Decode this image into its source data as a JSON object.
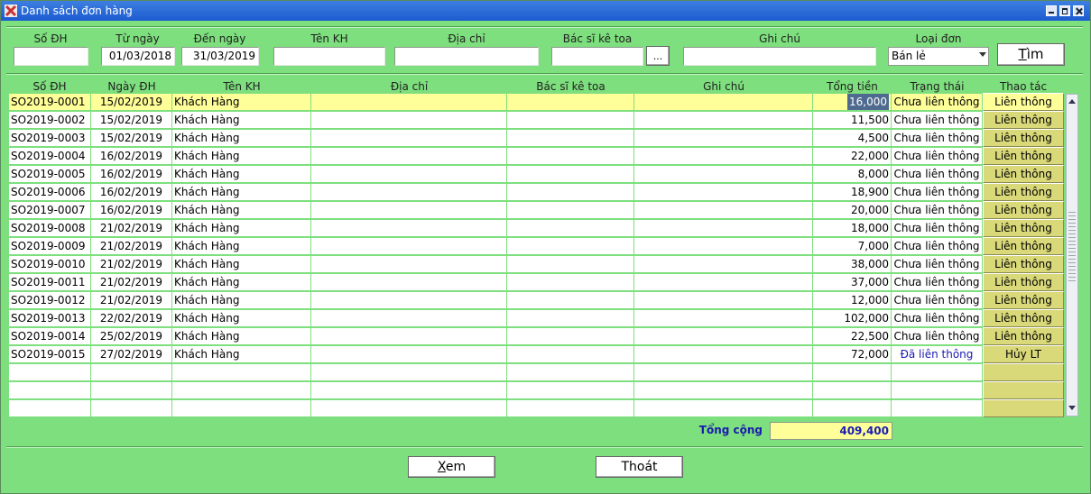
{
  "window": {
    "title": "Danh sách đơn hàng"
  },
  "filters": {
    "so_dh": {
      "label": "Số ĐH",
      "value": ""
    },
    "tu_ngay": {
      "label": "Từ ngày",
      "value": "01/03/2018"
    },
    "den_ngay": {
      "label": "Đến ngày",
      "value": "31/03/2019"
    },
    "ten_kh": {
      "label": "Tên KH",
      "value": ""
    },
    "dia_chi": {
      "label": "Địa chỉ",
      "value": ""
    },
    "bac_si": {
      "label": "Bác sĩ kê toa",
      "value": "",
      "browse": "..."
    },
    "ghi_chu": {
      "label": "Ghi chú",
      "value": ""
    },
    "loai_don": {
      "label": "Loại đơn",
      "value": "Bán lẻ"
    },
    "search_button": {
      "hot": "T",
      "rest": "ìm"
    }
  },
  "columns": [
    "Số ĐH",
    "Ngày ĐH",
    "Tên KH",
    "Địa chỉ",
    "Bác sĩ kê toa",
    "Ghi chú",
    "Tổng tiền",
    "Trạng thái",
    "Thao tác"
  ],
  "rows": [
    {
      "so": "SO2019-0001",
      "date": "15/02/2019",
      "kh": "Khách Hàng",
      "addr": "",
      "bs": "",
      "note": "",
      "total": "16,000",
      "status": "Chưa liên thông",
      "action": "Liên thông"
    },
    {
      "so": "SO2019-0002",
      "date": "15/02/2019",
      "kh": "Khách Hàng",
      "addr": "",
      "bs": "",
      "note": "",
      "total": "11,500",
      "status": "Chưa liên thông",
      "action": "Liên thông"
    },
    {
      "so": "SO2019-0003",
      "date": "15/02/2019",
      "kh": "Khách Hàng",
      "addr": "",
      "bs": "",
      "note": "",
      "total": "4,500",
      "status": "Chưa liên thông",
      "action": "Liên thông"
    },
    {
      "so": "SO2019-0004",
      "date": "16/02/2019",
      "kh": "Khách Hàng",
      "addr": "",
      "bs": "",
      "note": "",
      "total": "22,000",
      "status": "Chưa liên thông",
      "action": "Liên thông"
    },
    {
      "so": "SO2019-0005",
      "date": "16/02/2019",
      "kh": "Khách Hàng",
      "addr": "",
      "bs": "",
      "note": "",
      "total": "8,000",
      "status": "Chưa liên thông",
      "action": "Liên thông"
    },
    {
      "so": "SO2019-0006",
      "date": "16/02/2019",
      "kh": "Khách Hàng",
      "addr": "",
      "bs": "",
      "note": "",
      "total": "18,900",
      "status": "Chưa liên thông",
      "action": "Liên thông"
    },
    {
      "so": "SO2019-0007",
      "date": "16/02/2019",
      "kh": "Khách Hàng",
      "addr": "",
      "bs": "",
      "note": "",
      "total": "20,000",
      "status": "Chưa liên thông",
      "action": "Liên thông"
    },
    {
      "so": "SO2019-0008",
      "date": "21/02/2019",
      "kh": "Khách Hàng",
      "addr": "",
      "bs": "",
      "note": "",
      "total": "18,000",
      "status": "Chưa liên thông",
      "action": "Liên thông"
    },
    {
      "so": "SO2019-0009",
      "date": "21/02/2019",
      "kh": "Khách Hàng",
      "addr": "",
      "bs": "",
      "note": "",
      "total": "7,000",
      "status": "Chưa liên thông",
      "action": "Liên thông"
    },
    {
      "so": "SO2019-0010",
      "date": "21/02/2019",
      "kh": "Khách Hàng",
      "addr": "",
      "bs": "",
      "note": "",
      "total": "38,000",
      "status": "Chưa liên thông",
      "action": "Liên thông"
    },
    {
      "so": "SO2019-0011",
      "date": "21/02/2019",
      "kh": "Khách Hàng",
      "addr": "",
      "bs": "",
      "note": "",
      "total": "37,000",
      "status": "Chưa liên thông",
      "action": "Liên thông"
    },
    {
      "so": "SO2019-0012",
      "date": "21/02/2019",
      "kh": "Khách Hàng",
      "addr": "",
      "bs": "",
      "note": "",
      "total": "12,000",
      "status": "Chưa liên thông",
      "action": "Liên thông"
    },
    {
      "so": "SO2019-0013",
      "date": "22/02/2019",
      "kh": "Khách Hàng",
      "addr": "",
      "bs": "",
      "note": "",
      "total": "102,000",
      "status": "Chưa liên thông",
      "action": "Liên thông"
    },
    {
      "so": "SO2019-0014",
      "date": "25/02/2019",
      "kh": "Khách Hàng",
      "addr": "",
      "bs": "",
      "note": "",
      "total": "22,500",
      "status": "Chưa liên thông",
      "action": "Liên thông"
    },
    {
      "so": "SO2019-0015",
      "date": "27/02/2019",
      "kh": "Khách Hàng",
      "addr": "",
      "bs": "",
      "note": "",
      "total": "72,000",
      "status": "Đã liên thông",
      "action": "Hủy LT"
    },
    {
      "so": "",
      "date": "",
      "kh": "",
      "addr": "",
      "bs": "",
      "note": "",
      "total": "",
      "status": "",
      "action": ""
    },
    {
      "so": "",
      "date": "",
      "kh": "",
      "addr": "",
      "bs": "",
      "note": "",
      "total": "",
      "status": "",
      "action": ""
    },
    {
      "so": "",
      "date": "",
      "kh": "",
      "addr": "",
      "bs": "",
      "note": "",
      "total": "",
      "status": "",
      "action": ""
    }
  ],
  "summary": {
    "label": "Tổng cộng",
    "value": "409,400"
  },
  "footer": {
    "view_button": {
      "hot": "X",
      "rest": "em"
    },
    "exit_button": "Thoát"
  },
  "colors": {
    "background": "#7ddf7d",
    "titlebar": "#1c5bd0",
    "selected_row": "#ffff99",
    "action_button": "#d9d97a",
    "done_status": "#1a1ab0"
  }
}
